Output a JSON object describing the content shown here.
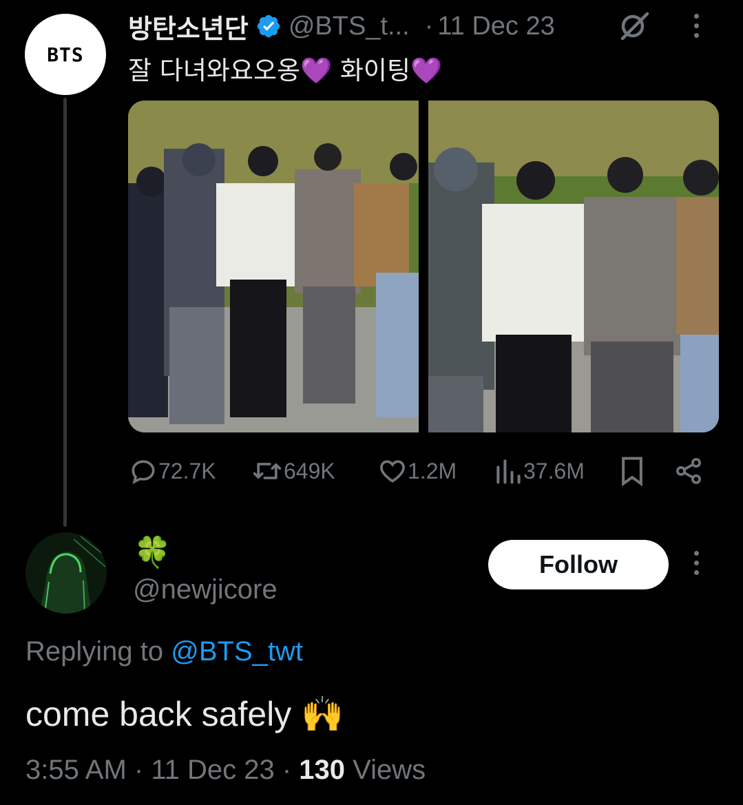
{
  "tweet": {
    "avatar_text": "BTS",
    "display_name": "방탄소년단",
    "handle": "@BTS_t...",
    "separator": "·",
    "date": "11 Dec 23",
    "text": "잘 다녀와요오옹💜 화이팅💜",
    "stats": {
      "replies": "72.7K",
      "reposts": "649K",
      "likes": "1.2M",
      "views": "37.6M"
    }
  },
  "reply": {
    "display_name": "🍀",
    "handle": "@newjicore",
    "follow_label": "Follow",
    "replying_prefix": "Replying to",
    "replying_mention": "@BTS_twt",
    "text": "come back safely 🙌",
    "time": "3:55 AM",
    "separator": "·",
    "date": "11 Dec 23",
    "views_count": "130",
    "views_label": "Views"
  },
  "icons": {
    "verified": "verified-badge-icon",
    "grok": "grok-icon",
    "more": "more-icon",
    "reply": "reply-icon",
    "repost": "repost-icon",
    "like": "like-icon",
    "views": "views-icon",
    "bookmark": "bookmark-icon",
    "share": "share-icon"
  },
  "colors": {
    "background": "#000000",
    "text": "#e7e9ea",
    "muted": "#71767b",
    "accent": "#1d9bf0",
    "thread_line": "#333639"
  }
}
